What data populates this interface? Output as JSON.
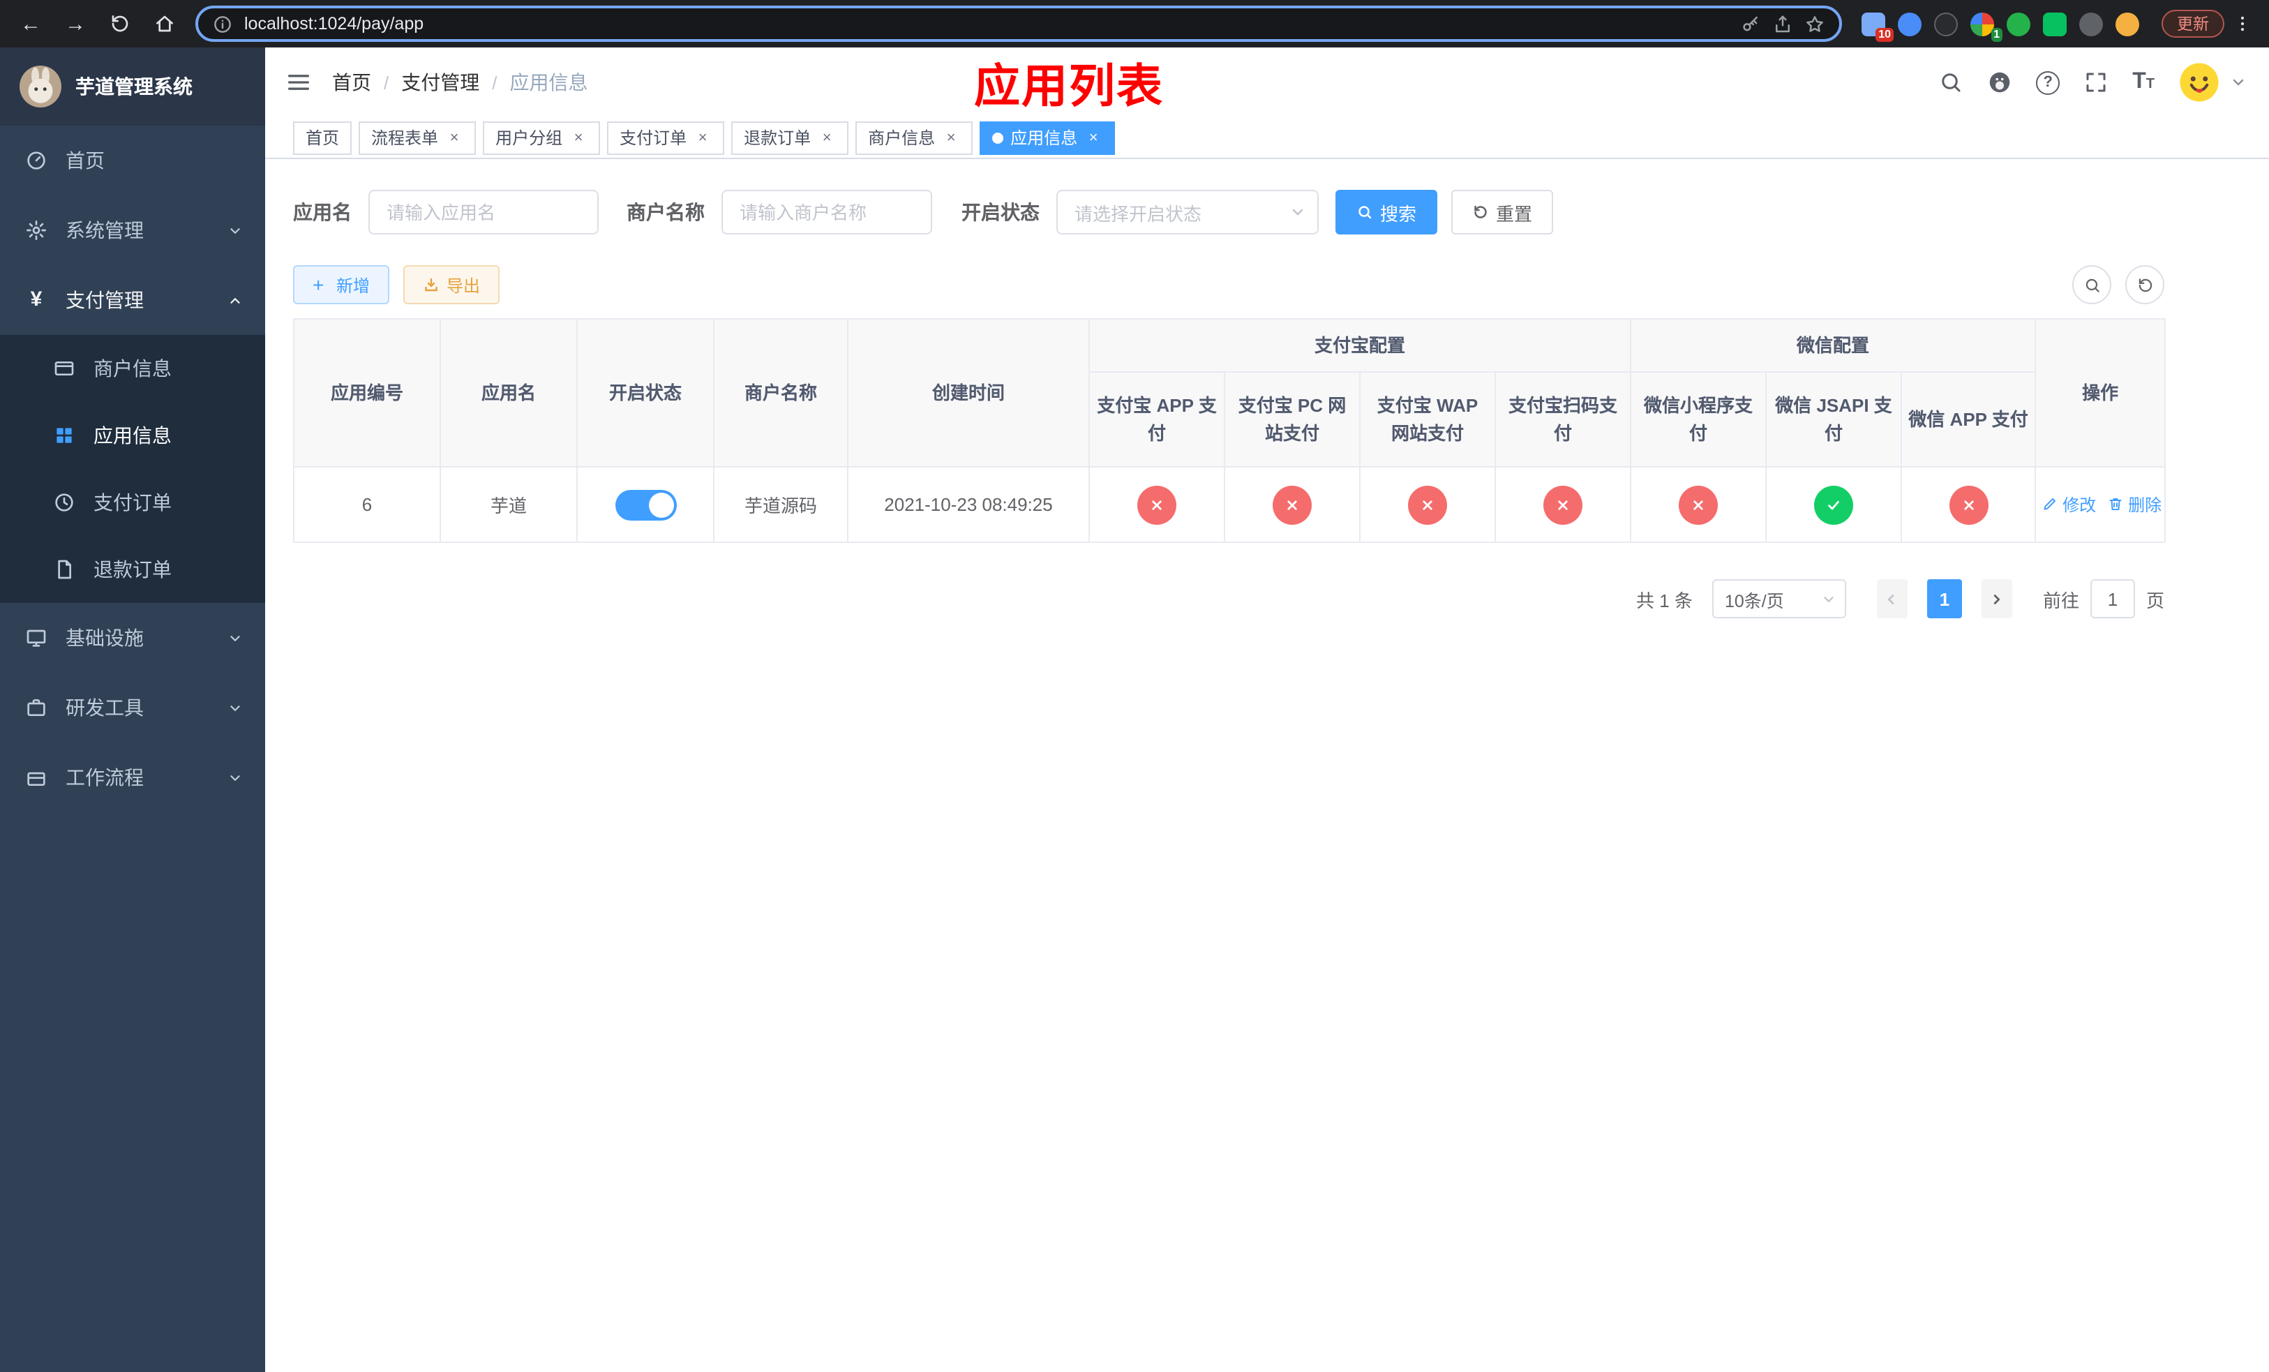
{
  "colors": {
    "accent": "#409eff",
    "success": "#13ce66",
    "danger": "#f56c6c",
    "warning": "#e6a23c",
    "page_title_red": "#ff0000",
    "sidebar_bg": "#304156",
    "sidebar_submenu_bg": "#1f2d3d"
  },
  "icons": {
    "search": "magnifier",
    "reset": "refresh",
    "add": "plus",
    "export": "download",
    "enabled_status": "check",
    "disabled_status": "cross"
  },
  "browser": {
    "url": "localhost:1024/pay/app",
    "update_label": "更新",
    "extension_badge_1": "10",
    "extension_badge_2": "1"
  },
  "sidebar": {
    "app_title": "芋道管理系统",
    "items": [
      {
        "label": "首页",
        "icon": "dashboard-icon",
        "expanded": false
      },
      {
        "label": "系统管理",
        "icon": "gear-icon",
        "expanded": false
      },
      {
        "label": "支付管理",
        "icon": "yen-icon",
        "expanded": true
      },
      {
        "label": "基础设施",
        "icon": "monitor-icon",
        "expanded": false
      },
      {
        "label": "研发工具",
        "icon": "toolbox-icon",
        "expanded": false
      },
      {
        "label": "工作流程",
        "icon": "workflow-icon",
        "expanded": false
      }
    ],
    "payment_children": [
      {
        "label": "商户信息",
        "icon": "credit-card-icon",
        "active": false
      },
      {
        "label": "应用信息",
        "icon": "grid-icon",
        "active": true
      },
      {
        "label": "支付订单",
        "icon": "clock-icon",
        "active": false
      },
      {
        "label": "退款订单",
        "icon": "file-icon",
        "active": false
      }
    ]
  },
  "navbar": {
    "breadcrumb": {
      "home": "首页",
      "separator": "/",
      "section": "支付管理",
      "current": "应用信息"
    },
    "page_title": "应用列表"
  },
  "tabs": [
    {
      "label": "首页",
      "closable": false,
      "active": false
    },
    {
      "label": "流程表单",
      "closable": true,
      "active": false
    },
    {
      "label": "用户分组",
      "closable": true,
      "active": false
    },
    {
      "label": "支付订单",
      "closable": true,
      "active": false
    },
    {
      "label": "退款订单",
      "closable": true,
      "active": false
    },
    {
      "label": "商户信息",
      "closable": true,
      "active": false
    },
    {
      "label": "应用信息",
      "closable": true,
      "active": true
    }
  ],
  "filters": {
    "app_name_label": "应用名",
    "app_name_placeholder": "请输入应用名",
    "app_name_value": "",
    "merchant_label": "商户名称",
    "merchant_placeholder": "请输入商户名称",
    "merchant_value": "",
    "status_label": "开启状态",
    "status_placeholder": "请选择开启状态",
    "search_label": "搜索",
    "reset_label": "重置"
  },
  "toolbar": {
    "add_label": "新增",
    "export_label": "导出"
  },
  "table": {
    "headers": {
      "app_id": "应用编号",
      "app_name": "应用名",
      "status": "开启状态",
      "merchant": "商户名称",
      "created": "创建时间",
      "alipay_group": "支付宝配置",
      "wechat_group": "微信配置",
      "alipay_app": "支付宝 APP 支付",
      "alipay_pc": "支付宝 PC 网站支付",
      "alipay_wap": "支付宝 WAP 网站支付",
      "alipay_qr": "支付宝扫码支付",
      "wechat_lite": "微信小程序支付",
      "wechat_jsapi": "微信 JSAPI 支付",
      "wechat_app": "微信 APP 支付",
      "actions": "操作"
    },
    "row": {
      "app_id": "6",
      "app_name": "芋道",
      "status_enabled": true,
      "merchant": "芋道源码",
      "created": "2021-10-23 08:49:25",
      "alipay_app": "disabled",
      "alipay_pc": "disabled",
      "alipay_wap": "disabled",
      "alipay_qr": "disabled",
      "wechat_lite": "disabled",
      "wechat_jsapi": "enabled",
      "wechat_app": "disabled",
      "edit_label": "修改",
      "delete_label": "删除"
    }
  },
  "pagination": {
    "total_label": "共 1 条",
    "page_size_label": "10条/页",
    "current_page": "1",
    "goto_label": "前往",
    "goto_value": "1",
    "goto_unit": "页"
  }
}
